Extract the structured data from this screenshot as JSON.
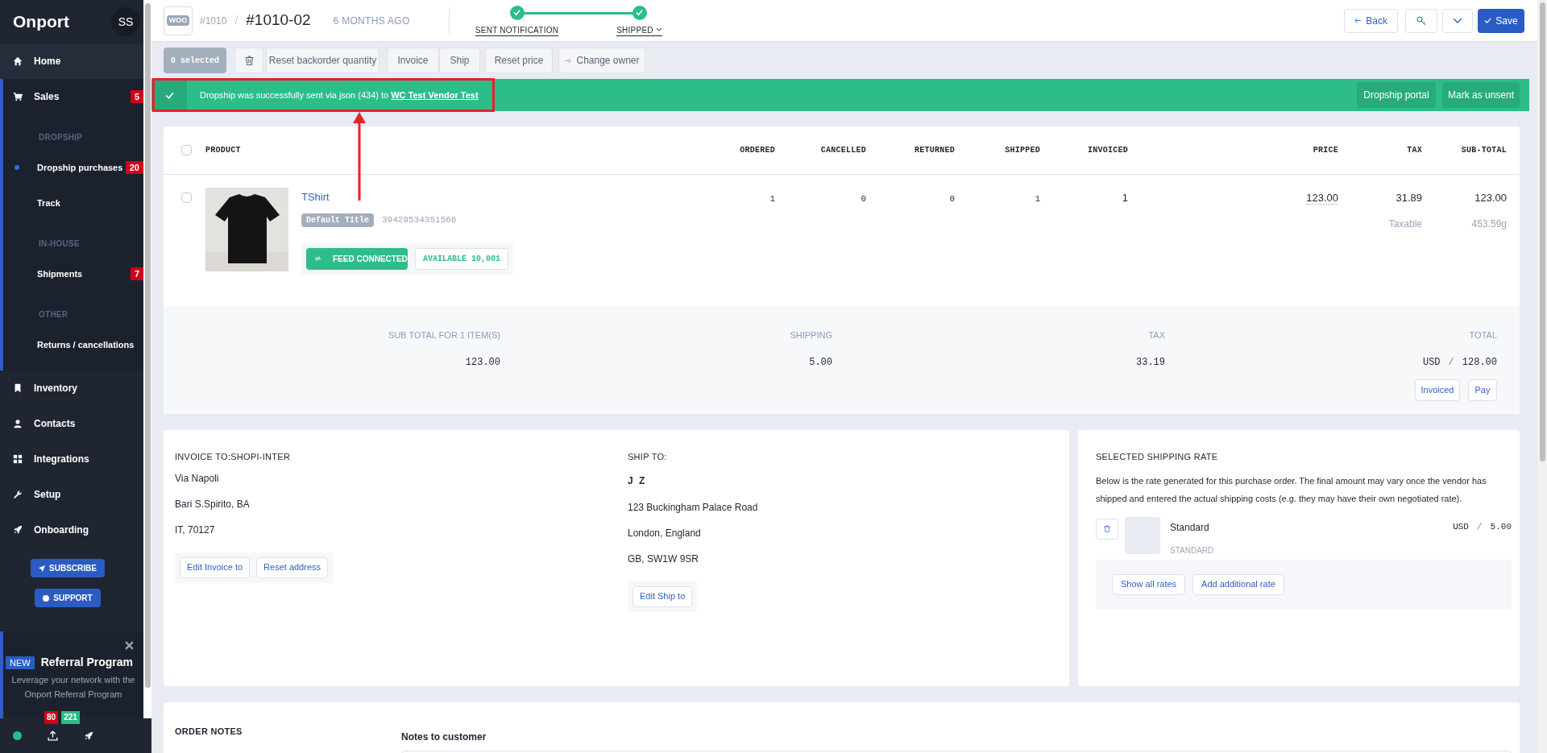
{
  "sidebar": {
    "logo": "Onport",
    "avatar": "SS",
    "nav": [
      {
        "kind": "item",
        "label": "Home",
        "selected": false
      },
      {
        "kind": "item",
        "label": "Sales",
        "badge": "5",
        "selected": false,
        "expanded": true,
        "children": [
          {
            "kind": "heading",
            "label": "DROPSHIP"
          },
          {
            "kind": "item",
            "label": "Dropship purchases",
            "badge": "20",
            "selected": true
          },
          {
            "kind": "item",
            "label": "Track",
            "selected": false
          },
          {
            "kind": "heading",
            "label": "IN-HOUSE"
          },
          {
            "kind": "item",
            "label": "Shipments",
            "badge": "7",
            "selected": false
          },
          {
            "kind": "heading",
            "label": "OTHER"
          },
          {
            "kind": "item",
            "label": "Returns / cancellations",
            "selected": false
          }
        ]
      },
      {
        "kind": "item",
        "label": "Inventory",
        "selected": false
      },
      {
        "kind": "item",
        "label": "Contacts",
        "selected": false
      },
      {
        "kind": "item",
        "label": "Integrations",
        "selected": false
      },
      {
        "kind": "item",
        "label": "Setup",
        "selected": false
      },
      {
        "kind": "item",
        "label": "Onboarding",
        "selected": false
      }
    ],
    "buttons": [
      "SUBSCRIBE",
      "SUPPORT"
    ],
    "referral": {
      "tag": "NEW",
      "title": "Referral Program",
      "text": "Leverage your network with the Onport Referral Program"
    },
    "footer_badges": [
      {
        "label": "80",
        "color": "#d0021b"
      },
      {
        "label": "221",
        "color": "#2bbd85"
      }
    ]
  },
  "header": {
    "store_logo": "WOO",
    "order": "#1010",
    "separator": "/",
    "purchase": "#1010-02",
    "age": "6 MONTHS AGO",
    "steps": [
      {
        "label": "SENT NOTIFICATION",
        "done": true,
        "dropdown": false
      },
      {
        "label": "SHIPPED",
        "done": true,
        "dropdown": true
      }
    ],
    "back": "Back",
    "save": "Save"
  },
  "toolbar": {
    "selected_count": "0 selected",
    "buttons": [
      {
        "kind": "trash"
      },
      {
        "kind": "text",
        "label": "Reset backorder quantity"
      },
      {
        "kind": "text",
        "label": "Invoice"
      },
      {
        "kind": "text",
        "label": "Ship"
      },
      {
        "kind": "text",
        "label": "Reset price"
      },
      {
        "kind": "arrow",
        "label": "Change owner"
      }
    ]
  },
  "banner": {
    "message": "Dropship was successfully sent via json (434) to ",
    "link": "WC Test Vendor Test",
    "buttons": [
      "Dropship portal",
      "Mark as unsent"
    ]
  },
  "table": {
    "checked": false,
    "product_column": "PRODUCT",
    "columns": [
      "ORDERED",
      "CANCELLED",
      "RETURNED",
      "SHIPPED",
      "INVOICED",
      "PRICE",
      "TAX",
      "SUB-TOTAL"
    ],
    "rows": [
      {
        "checked": false,
        "product": "TShirt",
        "variant": "Default Title",
        "sku": "39429534351566",
        "feed": "FEED CONNECTED",
        "available": "AVAILABLE 10,001",
        "cells": [
          "1",
          "0",
          "0",
          "1",
          "1",
          "123.00",
          "31.89",
          "123.00"
        ],
        "tax_note": "Taxable",
        "weight": "453.59g"
      }
    ]
  },
  "totals": {
    "items": [
      {
        "label": "SUB TOTAL FOR 1 ITEM(S)",
        "value": "123.00"
      },
      {
        "label": "SHIPPING",
        "value": "5.00"
      },
      {
        "label": "TAX",
        "value": "33.19"
      },
      {
        "label": "TOTAL",
        "currency": "USD",
        "separator": "/",
        "value": "128.00"
      }
    ],
    "buttons": [
      "Invoiced",
      "Pay"
    ]
  },
  "invoice_to": {
    "title": "INVOICE TO:SHOPI-INTER",
    "lines": [
      "Via Napoli",
      "Bari S.Spirito, BA",
      "IT, 70127"
    ],
    "buttons": [
      "Edit Invoice to",
      "Reset address"
    ]
  },
  "ship_to": {
    "title": "SHIP TO:",
    "name": "J Z",
    "lines": [
      "123 Buckingham Palace Road",
      "London, England",
      "GB, SW1W 9SR"
    ],
    "buttons": [
      "Edit Ship to"
    ]
  },
  "shipping_rate": {
    "title": "SELECTED SHIPPING RATE",
    "description": "Below is the rate generated for this purchase order. The final amount may vary once the vendor has shipped and entered the actual shipping costs (e.g. they may have their own negotiated rate).",
    "rate": {
      "name": "Standard",
      "code": "STANDARD",
      "currency": "USD",
      "separator": "/",
      "amount": "5.00"
    },
    "buttons": [
      "Show all rates",
      "Add additional rate"
    ]
  },
  "notes": {
    "title": "ORDER NOTES",
    "label": "Notes to customer"
  }
}
